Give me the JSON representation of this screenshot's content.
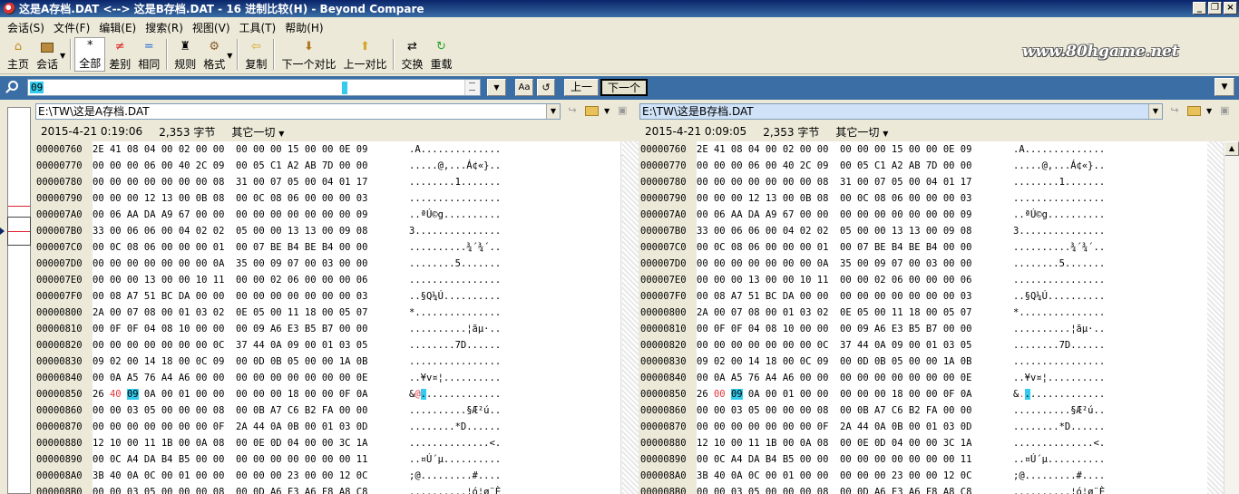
{
  "window": {
    "title": "这是A存档.DAT <--> 这是B存档.DAT - 16 进制比较(H) - Beyond Compare",
    "controls": [
      "_",
      "❐",
      "×"
    ]
  },
  "menu": [
    "会话(S)",
    "文件(F)",
    "编辑(E)",
    "搜索(R)",
    "视图(V)",
    "工具(T)",
    "帮助(H)"
  ],
  "toolbar": {
    "home": "主页",
    "session": "会话",
    "all": "全部",
    "diff": "差别",
    "same": "相同",
    "rules": "规则",
    "format": "格式",
    "copy": "复制",
    "next_diff": "下一个对比",
    "prev_diff": "上一对比",
    "swap": "交换",
    "reload": "重载"
  },
  "watermark": "www.80hgame.net",
  "search": {
    "value": "09",
    "case_btn": "Aa",
    "prev": "上一",
    "next": "下一个"
  },
  "left": {
    "path": "E:\\TW\\这是A存档.DAT",
    "date": "2015-4-21 0:19:06",
    "size": "2,353 字节",
    "other": "其它一切"
  },
  "right": {
    "path": "E:\\TW\\这是B存档.DAT",
    "date": "2015-4-21 0:09:05",
    "size": "2,353 字节",
    "other": "其它一切"
  },
  "rows": [
    {
      "off": "00000760",
      "lb": "2E 41 08 04 00 02 00 00  00 00 00 15 00 00 0E 09",
      "la": ".A..............",
      "rb": "2E 41 08 04 00 02 00 00  00 00 00 15 00 00 0E 09",
      "ra": ".A.............."
    },
    {
      "off": "00000770",
      "lb": "00 00 00 06 00 40 2C 09  00 05 C1 A2 AB 7D 00 00",
      "la": ".....@,...Á¢«}..",
      "rb": "00 00 00 06 00 40 2C 09  00 05 C1 A2 AB 7D 00 00",
      "ra": ".....@,...Á¢«}.."
    },
    {
      "off": "00000780",
      "lb": "00 00 00 00 00 00 00 08  31 00 07 05 00 04 01 17",
      "la": "........1.......",
      "rb": "00 00 00 00 00 00 00 08  31 00 07 05 00 04 01 17",
      "ra": "........1......."
    },
    {
      "off": "00000790",
      "lb": "00 00 00 12 13 00 0B 08  00 0C 08 06 00 00 00 03",
      "la": "................",
      "rb": "00 00 00 12 13 00 0B 08  00 0C 08 06 00 00 00 03",
      "ra": "................"
    },
    {
      "off": "000007A0",
      "lb": "00 06 AA DA A9 67 00 00  00 00 00 00 00 00 00 09",
      "la": "..ªÚ©g..........",
      "rb": "00 06 AA DA A9 67 00 00  00 00 00 00 00 00 00 09",
      "ra": "..ªÚ©g.........."
    },
    {
      "off": "000007B0",
      "lb": "33 00 06 06 00 04 02 02  05 00 00 13 13 00 09 08",
      "la": "3...............",
      "rb": "33 00 06 06 00 04 02 02  05 00 00 13 13 00 09 08",
      "ra": "3..............."
    },
    {
      "off": "000007C0",
      "lb": "00 0C 08 06 00 00 00 01  00 07 BE B4 BE B4 00 00",
      "la": "..........¾´¾´..",
      "rb": "00 0C 08 06 00 00 00 01  00 07 BE B4 BE B4 00 00",
      "ra": "..........¾´¾´.."
    },
    {
      "off": "000007D0",
      "lb": "00 00 00 00 00 00 00 0A  35 00 09 07 00 03 00 00",
      "la": "........5.......",
      "rb": "00 00 00 00 00 00 00 0A  35 00 09 07 00 03 00 00",
      "ra": "........5......."
    },
    {
      "off": "000007E0",
      "lb": "00 00 00 13 00 00 10 11  00 00 02 06 00 00 00 06",
      "la": "................",
      "rb": "00 00 00 13 00 00 10 11  00 00 02 06 00 00 00 06",
      "ra": "................"
    },
    {
      "off": "000007F0",
      "lb": "00 08 A7 51 BC DA 00 00  00 00 00 00 00 00 00 03",
      "la": "..§Q¼Ú..........",
      "rb": "00 08 A7 51 BC DA 00 00  00 00 00 00 00 00 00 03",
      "ra": "..§Q¼Ú.........."
    },
    {
      "off": "00000800",
      "lb": "2A 00 07 08 00 01 03 02  0E 05 00 11 18 00 05 07",
      "la": "*...............",
      "rb": "2A 00 07 08 00 01 03 02  0E 05 00 11 18 00 05 07",
      "ra": "*..............."
    },
    {
      "off": "00000810",
      "lb": "00 0F 0F 04 08 10 00 00  00 09 A6 E3 B5 B7 00 00",
      "la": "..........¦ãµ·..",
      "rb": "00 0F 0F 04 08 10 00 00  00 09 A6 E3 B5 B7 00 00",
      "ra": "..........¦ãµ·.."
    },
    {
      "off": "00000820",
      "lb": "00 00 00 00 00 00 00 0C  37 44 0A 09 00 01 03 05",
      "la": "........7D......",
      "rb": "00 00 00 00 00 00 00 0C  37 44 0A 09 00 01 03 05",
      "ra": "........7D......"
    },
    {
      "off": "00000830",
      "lb": "09 02 00 14 18 00 0C 09  00 0D 0B 05 00 00 1A 0B",
      "la": "................",
      "rb": "09 02 00 14 18 00 0C 09  00 0D 0B 05 00 00 1A 0B",
      "ra": "................"
    },
    {
      "off": "00000840",
      "lb": "00 0A A5 76 A4 A6 00 00  00 00 00 00 00 00 00 0E",
      "la": "..¥v¤¦..........",
      "rb": "00 0A A5 76 A4 A6 00 00  00 00 00 00 00 00 00 0E",
      "ra": "..¥v¤¦.........."
    },
    {
      "off": "00000850",
      "lb0": "26 ",
      "lbr": "40",
      "lbs": " ",
      "lbc": "09",
      "lbt": " 0A 00 01 00 00  00 00 00 18 00 00 0F 0A",
      "la0": "&",
      "lar": "@",
      "lac": ".",
      "lat": ".............",
      "rb0": "26 ",
      "rbr": "00",
      "rbs": " ",
      "rbc": "09",
      "rbt": " 0A 00 01 00 00  00 00 00 18 00 00 0F 0A",
      "ra0": "&",
      "rar": ".",
      "rac": ".",
      "rat": "............."
    },
    {
      "off": "00000860",
      "lb": "00 00 03 05 00 00 00 08  00 0B A7 C6 B2 FA 00 00",
      "la": "..........§Æ²ú..",
      "rb": "00 00 03 05 00 00 00 08  00 0B A7 C6 B2 FA 00 00",
      "ra": "..........§Æ²ú.."
    },
    {
      "off": "00000870",
      "lb": "00 00 00 00 00 00 00 0F  2A 44 0A 0B 00 01 03 0D",
      "la": "........*D......",
      "rb": "00 00 00 00 00 00 00 0F  2A 44 0A 0B 00 01 03 0D",
      "ra": "........*D......"
    },
    {
      "off": "00000880",
      "lb": "12 10 00 11 1B 00 0A 08  00 0E 0D 04 00 00 3C 1A",
      "la": "..............<.",
      "rb": "12 10 00 11 1B 00 0A 08  00 0E 0D 04 00 00 3C 1A",
      "ra": "..............<."
    },
    {
      "off": "00000890",
      "lb": "00 0C A4 DA B4 B5 00 00  00 00 00 00 00 00 00 11",
      "la": "..¤Ú´µ..........",
      "rb": "00 0C A4 DA B4 B5 00 00  00 00 00 00 00 00 00 11",
      "ra": "..¤Ú´µ.........."
    },
    {
      "off": "000008A0",
      "lb": "3B 40 0A 0C 00 01 00 00  00 00 00 23 00 00 12 0C",
      "la": ";@.........#....",
      "rb": "3B 40 0A 0C 00 01 00 00  00 00 00 23 00 00 12 0C",
      "ra": ";@.........#...."
    },
    {
      "off": "000008B0",
      "lb": "00 00 03 05 00 00 00 08  00 0D A6 F3 A6 F8 A8 C8",
      "la": "..........¦ó¦ø¨È",
      "rb": "00 00 03 05 00 00 00 08  00 0D A6 F3 A6 F8 A8 C8",
      "ra": "..........¦ó¦ø¨È"
    }
  ]
}
